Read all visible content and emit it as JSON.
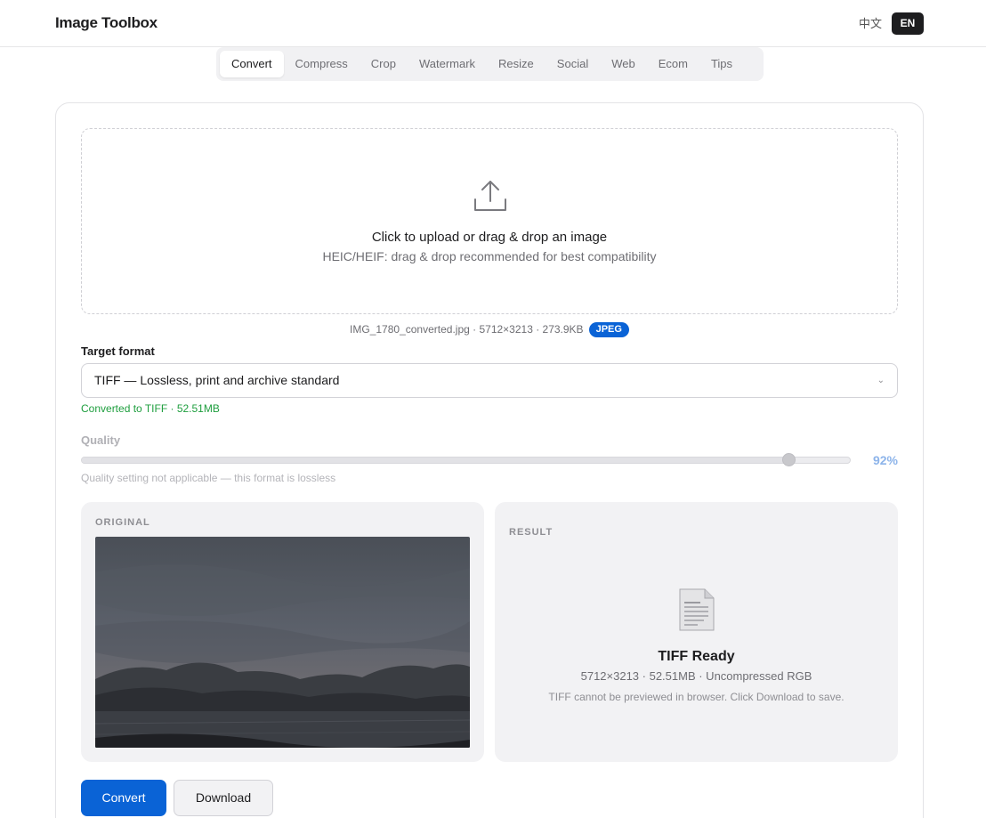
{
  "header": {
    "brand": "Image Toolbox",
    "lang_zh": "中文",
    "lang_en": "EN"
  },
  "tabs": [
    {
      "label": "Convert",
      "active": true
    },
    {
      "label": "Compress"
    },
    {
      "label": "Crop"
    },
    {
      "label": "Watermark"
    },
    {
      "label": "Resize"
    },
    {
      "label": "Social"
    },
    {
      "label": "Web"
    },
    {
      "label": "Ecom"
    },
    {
      "label": "Tips"
    }
  ],
  "upload": {
    "icon": "upload-icon",
    "title": "Click to upload or drag & drop an image",
    "subtitle": "HEIC/HEIF: drag & drop recommended for best compatibility"
  },
  "file": {
    "info": "IMG_1780_converted.jpg · 5712×3213 · 273.9KB",
    "badge": "JPEG"
  },
  "format": {
    "label": "Target format",
    "selected": "TIFF — Lossless, print and archive standard",
    "status": "Converted to TIFF · 52.51MB"
  },
  "quality": {
    "label": "Quality",
    "value_text": "92%",
    "value": 0.92,
    "note": "Quality setting not applicable — this format is lossless"
  },
  "original": {
    "title": "ORIGINAL"
  },
  "result": {
    "title": "RESULT",
    "icon": "document-icon",
    "heading": "TIFF Ready",
    "meta": "5712×3213 · 52.51MB · Uncompressed RGB",
    "note": "TIFF cannot be previewed in browser. Click Download to save."
  },
  "actions": {
    "convert": "Convert",
    "download": "Download"
  },
  "colors": {
    "accent": "#0a63d6",
    "success": "#1e9e3e"
  }
}
